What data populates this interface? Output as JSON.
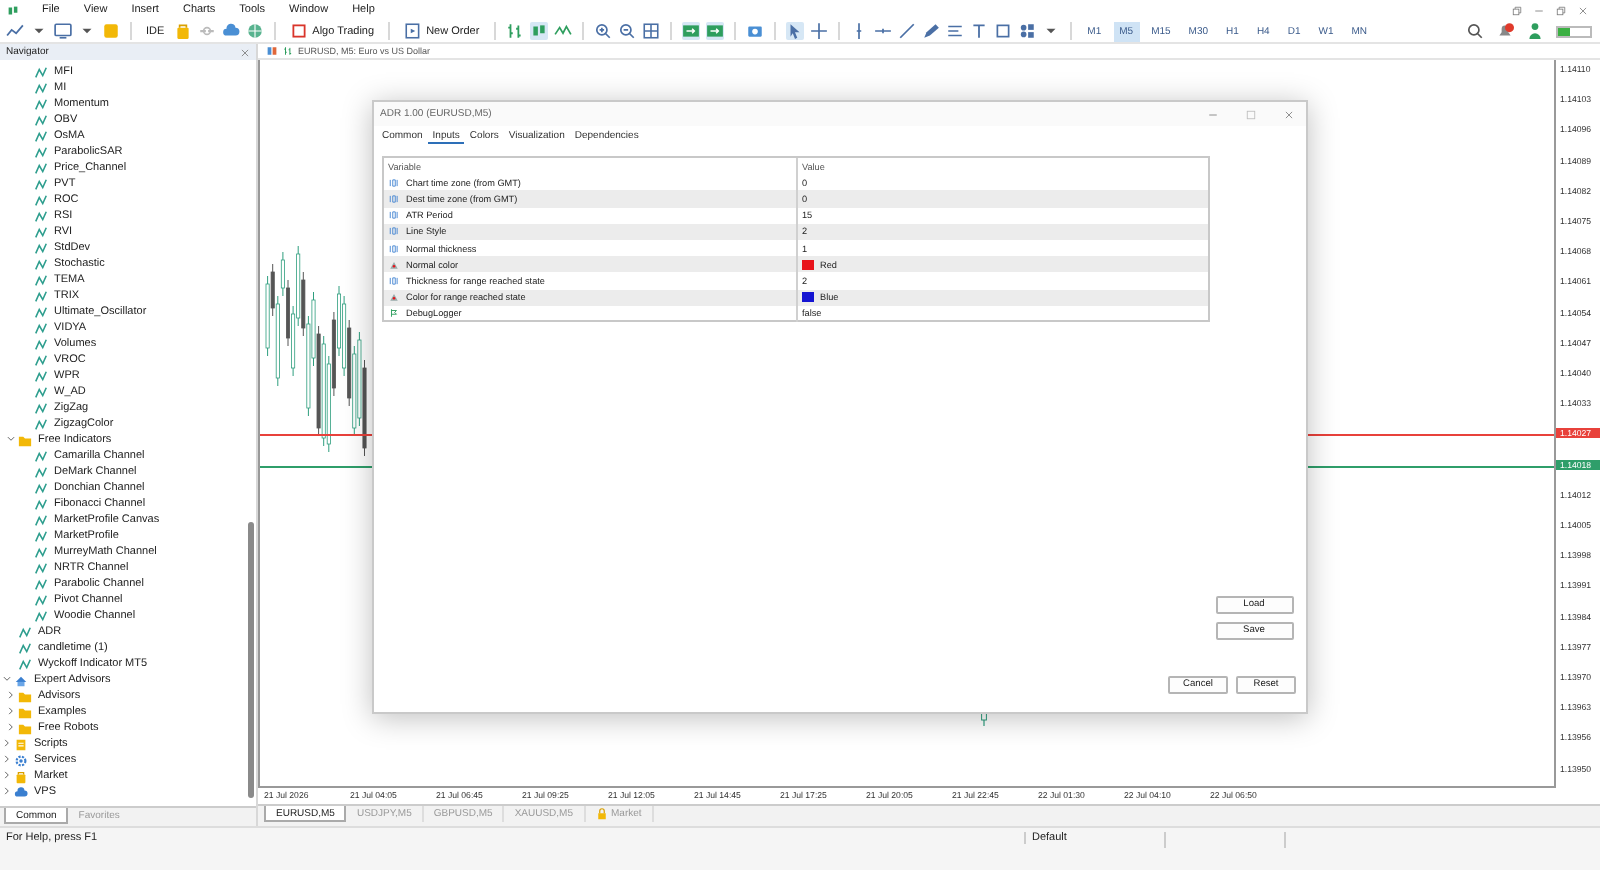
{
  "menu": [
    "File",
    "View",
    "Insert",
    "Charts",
    "Tools",
    "Window",
    "Help"
  ],
  "toolbar": {
    "buttons": [
      {
        "kind": "ide",
        "label": "IDE"
      },
      {
        "kind": "algo",
        "label": "Algo Trading"
      },
      {
        "kind": "order",
        "label": "New Order"
      }
    ],
    "timeframes": [
      {
        "label": "M1",
        "selected": false
      },
      {
        "label": "M5",
        "selected": true
      },
      {
        "label": "M15",
        "selected": false
      },
      {
        "label": "M30",
        "selected": false
      },
      {
        "label": "H1",
        "selected": false
      },
      {
        "label": "H4",
        "selected": false
      },
      {
        "label": "D1",
        "selected": false
      },
      {
        "label": "W1",
        "selected": false
      },
      {
        "label": "MN",
        "selected": false
      }
    ]
  },
  "navigator": {
    "title": "Navigator",
    "tree": [
      {
        "kind": "offscreen",
        "children": [
          {
            "kind": "offscreen",
            "children": [
              {
                "kind": "indicator",
                "label": "MFI"
              },
              {
                "kind": "indicator",
                "label": "MI"
              },
              {
                "kind": "indicator",
                "label": "Momentum"
              },
              {
                "kind": "indicator",
                "label": "OBV"
              },
              {
                "kind": "indicator",
                "label": "OsMA"
              },
              {
                "kind": "indicator",
                "label": "ParabolicSAR"
              },
              {
                "kind": "indicator",
                "label": "Price_Channel"
              },
              {
                "kind": "indicator",
                "label": "PVT"
              },
              {
                "kind": "indicator",
                "label": "ROC"
              },
              {
                "kind": "indicator",
                "label": "RSI"
              },
              {
                "kind": "indicator",
                "label": "RVI"
              },
              {
                "kind": "indicator",
                "label": "StdDev"
              },
              {
                "kind": "indicator",
                "label": "Stochastic"
              },
              {
                "kind": "indicator",
                "label": "TEMA"
              },
              {
                "kind": "indicator",
                "label": "TRIX"
              },
              {
                "kind": "indicator",
                "label": "Ultimate_Oscillator"
              },
              {
                "kind": "indicator",
                "label": "VIDYA"
              },
              {
                "kind": "indicator",
                "label": "Volumes"
              },
              {
                "kind": "indicator",
                "label": "VROC"
              },
              {
                "kind": "indicator",
                "label": "WPR"
              },
              {
                "kind": "indicator",
                "label": "W_AD"
              },
              {
                "kind": "indicator",
                "label": "ZigZag"
              },
              {
                "kind": "indicator",
                "label": "ZigzagColor"
              }
            ]
          },
          {
            "kind": "folder",
            "label": "Free Indicators",
            "expanded": true,
            "children": [
              {
                "kind": "indicator",
                "label": "Camarilla Channel"
              },
              {
                "kind": "indicator",
                "label": "DeMark Channel"
              },
              {
                "kind": "indicator",
                "label": "Donchian Channel"
              },
              {
                "kind": "indicator",
                "label": "Fibonacci Channel"
              },
              {
                "kind": "indicator",
                "label": "MarketProfile Canvas"
              },
              {
                "kind": "indicator",
                "label": "MarketProfile"
              },
              {
                "kind": "indicator",
                "label": "MurreyMath Channel"
              },
              {
                "kind": "indicator",
                "label": "NRTR Channel"
              },
              {
                "kind": "indicator",
                "label": "Parabolic Channel"
              },
              {
                "kind": "indicator",
                "label": "Pivot Channel"
              },
              {
                "kind": "indicator",
                "label": "Woodie Channel"
              }
            ]
          },
          {
            "kind": "indicator",
            "label": "ADR"
          },
          {
            "kind": "indicator",
            "label": "candletime (1)"
          },
          {
            "kind": "indicator",
            "label": "Wyckoff Indicator MT5"
          }
        ]
      },
      {
        "kind": "experts",
        "label": "Expert Advisors",
        "expanded": true,
        "children": [
          {
            "kind": "folder",
            "label": "Advisors",
            "expanded": false
          },
          {
            "kind": "folder",
            "label": "Examples",
            "expanded": false
          },
          {
            "kind": "folder",
            "label": "Free Robots",
            "expanded": false
          }
        ]
      },
      {
        "kind": "scripts",
        "label": "Scripts",
        "expanded": false
      },
      {
        "kind": "services",
        "label": "Services",
        "expanded": false
      },
      {
        "kind": "market",
        "label": "Market",
        "expanded": false
      },
      {
        "kind": "vps",
        "label": "VPS",
        "expanded": false
      }
    ],
    "tabs": [
      {
        "label": "Common",
        "selected": true
      },
      {
        "label": "Favorites",
        "selected": false
      }
    ]
  },
  "chart": {
    "title": "EURUSD, M5: Euro vs US Dollar",
    "price_labels": [
      {
        "text": "1.14110"
      },
      {
        "text": "1.14103"
      },
      {
        "text": "1.14096"
      },
      {
        "text": "1.14089"
      },
      {
        "text": "1.14082"
      },
      {
        "text": "1.14075"
      },
      {
        "text": "1.14068"
      },
      {
        "text": "1.14061"
      },
      {
        "text": "1.14054"
      },
      {
        "text": "1.14047"
      },
      {
        "text": "1.14040"
      },
      {
        "text": "1.14033"
      },
      {
        "text": "1.14027",
        "color": "#e8413b"
      },
      {
        "text": "1.14018",
        "color": "#2f9e6a"
      },
      {
        "text": "1.14012"
      },
      {
        "text": "1.14005"
      },
      {
        "text": "1.13998"
      },
      {
        "text": "1.13991"
      },
      {
        "text": "1.13984"
      },
      {
        "text": "1.13977"
      },
      {
        "text": "1.13970"
      },
      {
        "text": "1.13963"
      },
      {
        "text": "1.13956"
      },
      {
        "text": "1.13950"
      }
    ],
    "time_labels": [
      "21 Jul 2026",
      "21 Jul 04:05",
      "21 Jul 06:45",
      "21 Jul 09:25",
      "21 Jul 12:05",
      "21 Jul 14:45",
      "21 Jul 17:25",
      "21 Jul 20:05",
      "21 Jul 22:45",
      "22 Jul 01:30",
      "22 Jul 04:10",
      "22 Jul 06:50"
    ],
    "tabs": [
      {
        "label": "EURUSD,M5",
        "selected": true,
        "locked": false
      },
      {
        "label": "USDJPY,M5",
        "selected": false,
        "locked": false
      },
      {
        "label": "GBPUSD,M5",
        "selected": false,
        "locked": false
      },
      {
        "label": "XAUUSD,M5",
        "selected": false,
        "locked": false
      },
      {
        "label": "Market",
        "selected": false,
        "locked": true
      }
    ]
  },
  "dialog": {
    "title": "ADR 1.00 (EURUSD,M5)",
    "tabs": [
      {
        "label": "Common",
        "selected": false
      },
      {
        "label": "Inputs",
        "selected": true
      },
      {
        "label": "Colors",
        "selected": false
      },
      {
        "label": "Visualization",
        "selected": false
      },
      {
        "label": "Dependencies",
        "selected": false
      }
    ],
    "columns": [
      "Variable",
      "Value"
    ],
    "rows": [
      {
        "kind": "int",
        "variable": "Chart time zone (from GMT)",
        "value": "0"
      },
      {
        "kind": "int",
        "variable": "Dest time zone (from GMT)",
        "value": "0"
      },
      {
        "kind": "int",
        "variable": "ATR Period",
        "value": "15"
      },
      {
        "kind": "int",
        "variable": "Line Style",
        "value": "2"
      },
      {
        "kind": "int",
        "variable": "Normal thickness",
        "value": "1"
      },
      {
        "kind": "color",
        "variable": "Normal color",
        "value": "Red",
        "color": "#e8141b"
      },
      {
        "kind": "int",
        "variable": "Thickness for range reached state",
        "value": "2"
      },
      {
        "kind": "color",
        "variable": "Color for range reached state",
        "value": "Blue",
        "color": "#1414d2"
      },
      {
        "kind": "bool",
        "variable": "DebugLogger",
        "value": "false"
      }
    ],
    "side_buttons": [
      "Load",
      "Save"
    ],
    "footer_buttons": [
      "Cancel",
      "Reset"
    ]
  },
  "status_bar": {
    "help": "For Help, press F1",
    "profile": "Default"
  }
}
